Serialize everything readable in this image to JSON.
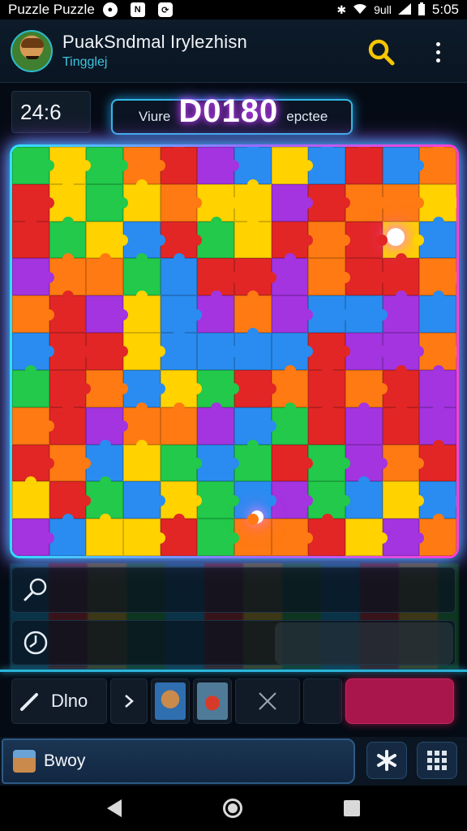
{
  "status_bar": {
    "app_label": "Puzzle Puzzle",
    "time": "5:05",
    "signal_text": "9ull",
    "icons": [
      "notification-icon",
      "dnd-icon",
      "update-icon",
      "bluetooth-icon",
      "wifi-icon",
      "signal-icon",
      "battery-icon"
    ]
  },
  "header": {
    "title": "PuakSndmal Irylezhisn",
    "subtitle": "Tingglej",
    "search_icon": "search-icon",
    "menu_icon": "more-vert-icon",
    "accent": "#f6c600"
  },
  "info": {
    "timer": "24:6",
    "score_label_left": "Viure",
    "score_value": "D0180",
    "score_label_right": "epctee"
  },
  "board": {
    "colors": [
      "#2a8cf0",
      "#ffd200",
      "#e22626",
      "#22c94a",
      "#a334e0",
      "#ff7a12"
    ],
    "rows": 11,
    "cols": 12
  },
  "tool_rows": [
    {
      "icon": "magnifier-icon"
    },
    {
      "icon": "timer-icon"
    }
  ],
  "action_bar": {
    "draw_label": "Dlno",
    "draw_icon": "pencil-icon",
    "next_icon": "chevron-right-icon",
    "close_icon": "close-icon",
    "primary_color": "#a9164b"
  },
  "bottom_bar": {
    "user_label": "Bwoy",
    "star_icon": "asterisk-icon",
    "grid_icon": "grid-icon"
  },
  "nav": {
    "icons": [
      "back-icon",
      "home-icon",
      "recents-icon"
    ]
  }
}
